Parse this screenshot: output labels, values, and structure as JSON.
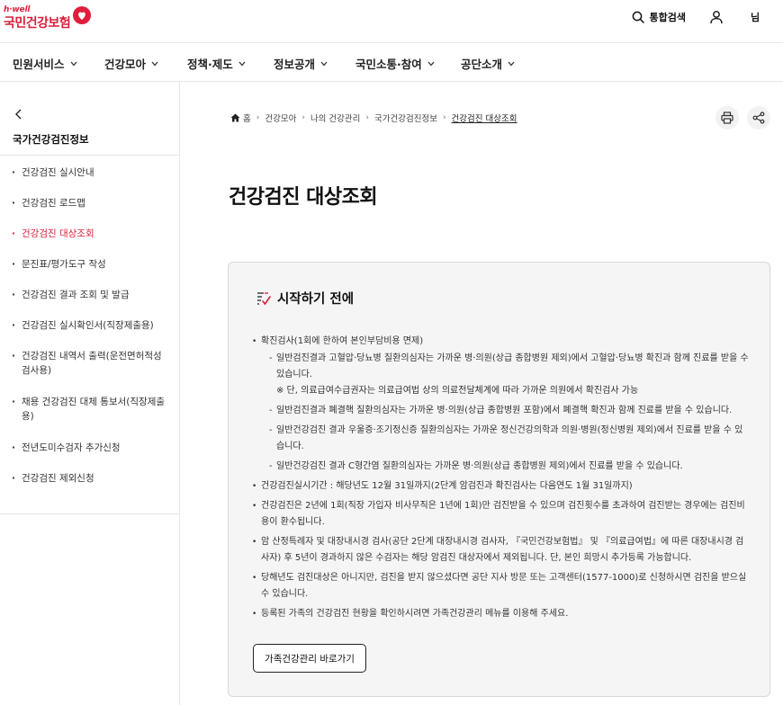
{
  "header": {
    "logo_tag": "h·well",
    "logo_name": "국민건강보험",
    "search_label": "통합검색",
    "user_name": "님"
  },
  "gnb": [
    {
      "label": "민원서비스"
    },
    {
      "label": "건강모아"
    },
    {
      "label": "정책·제도"
    },
    {
      "label": "정보공개"
    },
    {
      "label": "국민소통·참여"
    },
    {
      "label": "공단소개"
    }
  ],
  "sidebar": {
    "title": "국가건강검진정보",
    "items": [
      {
        "label": "건강검진 실시안내"
      },
      {
        "label": "건강검진 로드맵"
      },
      {
        "label": "건강검진 대상조회"
      },
      {
        "label": "문진표/평가도구 작성"
      },
      {
        "label": "건강검진 결과 조회 및 발급"
      },
      {
        "label": "건강검진 실시확인서(직장제출용)"
      },
      {
        "label": "건강검진 내역서 출력(운전면허적성검사용)"
      },
      {
        "label": "채용 건강검진 대체 통보서(직장제출용)"
      },
      {
        "label": "전년도미수검자 추가신청"
      },
      {
        "label": "건강검진 제외신청"
      }
    ],
    "active_index": 2
  },
  "breadcrumb": [
    "홈",
    "건강모아",
    "나의 건강관리",
    "국가건강검진정보",
    "건강검진 대상조회"
  ],
  "page_title": "건강검진 대상조회",
  "notice": {
    "title": "시작하기 전에",
    "items": [
      {
        "text": "확진검사(1회에 한하여 본인부담비용 면제)",
        "sub": [
          {
            "text": "일반검진결과 고혈압·당뇨병 질환의심자는 가까운 병·의원(상급 종합병원 제외)에서 고혈압·당뇨병 확진과 함께 진료를 받을 수 있습니다.",
            "note": "※ 단, 의료급여수급권자는 의료급여법 상의 의료전달체계에 따라 가까운 의원에서 확진검사 가능"
          },
          {
            "text": "일반검진결과 폐결핵 질환의심자는 가까운 병·의원(상급 종합병원 포함)에서 폐결핵 확진과 함께 진료를 받을 수 있습니다.",
            "note": ""
          },
          {
            "text": "일반건강검진 결과 우울증·조기정신증 질환의심자는 가까운 정신건강의학과 의원·병원(정신병원 제외)에서 진료를 받을 수 있습니다.",
            "note": ""
          },
          {
            "text": "일반건강검진 결과 C형간염 질환의심자는 가까운 병·의원(상급 종합병원 제외)에서 진료를 받을 수 있습니다.",
            "note": ""
          }
        ]
      },
      {
        "text": "건강검진실시기간 : 해당년도 12월 31일까지(2단계 암검진과 확진검사는 다음연도 1월 31일까지)",
        "sub": []
      },
      {
        "text": "건강검진은 2년에 1회(직장 가입자 비사무직은 1년에 1회)만 검진받을 수 있으며 검진횟수를 초과하여 검진받는 경우에는 검진비용이 환수됩니다.",
        "sub": []
      },
      {
        "text": "암 산정특례자 및 대장내시경 검사(공단 2단계 대장내시경 검사자, 『국민건강보험법』 및 『의료급여법』에 따른 대장내시경 검사자) 후 5년이 경과하지 않은 수검자는 해당 암검진 대상자에서 제외됩니다. 단, 본인 희망시 추가등록 가능합니다.",
        "sub": []
      },
      {
        "text": "당해년도 검진대상은 아니지만, 검진을 받지 않으셨다면 공단 지사 방문 또는 고객센터(1577-1000)로 신청하시면 검진을 받으실 수 있습니다.",
        "sub": []
      },
      {
        "text": "등록된 가족의 건강검진 현황을 확인하시려면 가족건강관리 메뉴를 이용해 주세요.",
        "sub": []
      }
    ],
    "button_label": "가족건강관리 바로가기"
  },
  "colors": {
    "brand": "#d8203c",
    "panel_bg": "#f5f5f5"
  }
}
